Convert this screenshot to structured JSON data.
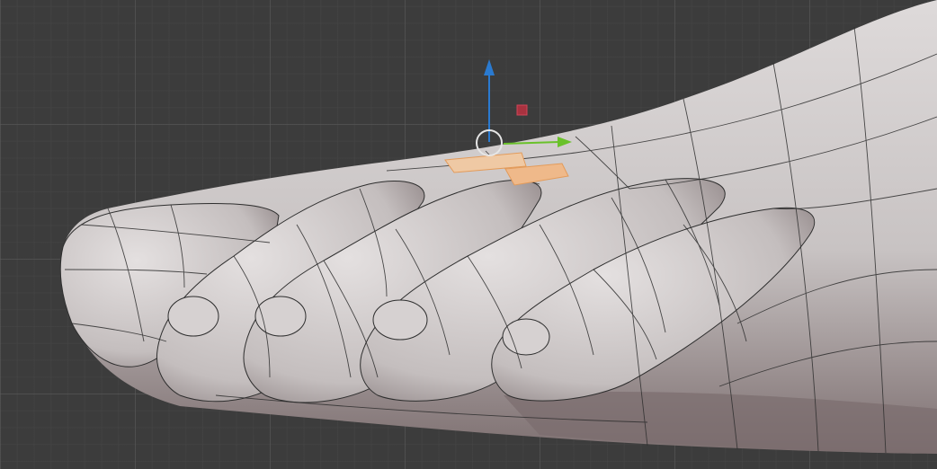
{
  "viewport": {
    "name": "3D Viewport",
    "mode": "edit-mode-face-select",
    "background_color": "#3c3c3c",
    "grid_major_color": "#5a5a5a",
    "grid_minor_color": "#464646"
  },
  "model": {
    "subject": "foot-toes-mesh",
    "surface_color": "#c9c4c4",
    "wire_color": "#2e2e2e",
    "selected_face_color": "#efb98a"
  },
  "gizmo": {
    "x_axis_color": "#c8304a",
    "y_axis_color": "#6ac12a",
    "z_axis_color": "#2a7ad0",
    "pivot_color": "#e6e6e6"
  }
}
